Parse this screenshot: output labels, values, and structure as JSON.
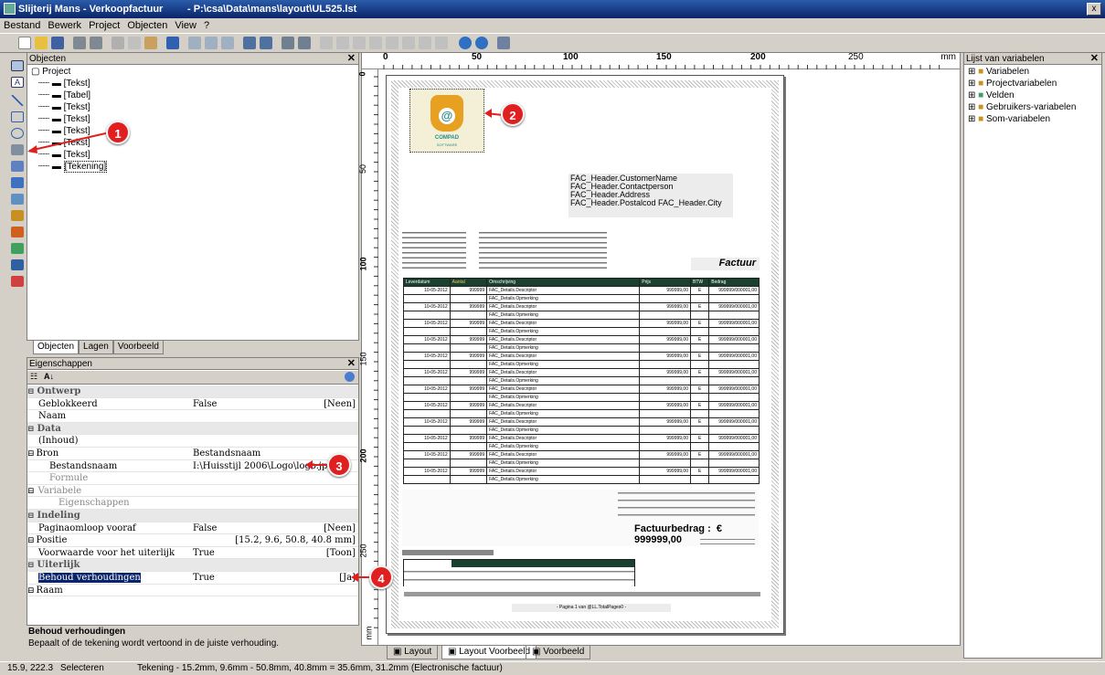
{
  "window": {
    "title": "Slijterij Mans - Verkoopfactuur",
    "path": "- P:\\csa\\Data\\mans\\layout\\UL525.lst",
    "close": "x"
  },
  "menu": [
    "Bestand",
    "Bewerk",
    "Project",
    "Objecten",
    "View",
    "?"
  ],
  "objects_panel": {
    "title": "Objecten",
    "root": "Project",
    "items": [
      "[Tekst]",
      "[Tabel]",
      "[Tekst]",
      "[Tekst]",
      "[Tekst]",
      "[Tekst]",
      "[Tekst]",
      "[Tekening]"
    ],
    "tabs": [
      "Objecten",
      "Lagen",
      "Voorbeeld"
    ]
  },
  "properties_panel": {
    "title": "Eigenschappen",
    "rows": [
      {
        "name": "Ontwerp",
        "type": "cat"
      },
      {
        "name": "Geblokkeerd",
        "value": "False",
        "right": "[Neen]"
      },
      {
        "name": "Naam",
        "value": "",
        "right": ""
      },
      {
        "name": "Data",
        "type": "cat"
      },
      {
        "name": "(Inhoud)",
        "value": "",
        "right": ""
      },
      {
        "name": "Bron",
        "value": "Bestandsnaam",
        "right": ""
      },
      {
        "name": "Bestandsnaam",
        "value": "I:\\Huisstijl 2006\\Logo\\logo.jpg",
        "right": ""
      },
      {
        "name": "Formule",
        "value": "",
        "right": ""
      },
      {
        "name": "Variabele",
        "value": "",
        "right": ""
      },
      {
        "name": "Eigenschappen",
        "value": "",
        "right": ""
      },
      {
        "name": "Indeling",
        "type": "cat"
      },
      {
        "name": "Paginaomloop vooraf",
        "value": "False",
        "right": "[Neen]"
      },
      {
        "name": "Positie",
        "value": "",
        "right": "[15.2, 9.6, 50.8, 40.8 mm]"
      },
      {
        "name": "Voorwaarde voor het uiterlijk",
        "value": "True",
        "right": "[Toon]"
      },
      {
        "name": "Uiterlijk",
        "type": "cat"
      },
      {
        "name": "Behoud verhoudingen",
        "value": "True",
        "right": "[Ja]"
      },
      {
        "name": "Raam",
        "value": "",
        "right": ""
      }
    ],
    "help_title": "Behoud verhoudingen",
    "help_text": "Bepaalt of de tekening wordt vertoond in de juiste verhouding."
  },
  "ruler": {
    "unit": "mm",
    "h_ticks": [
      "0",
      "50",
      "100",
      "150",
      "200",
      "250"
    ],
    "v_ticks": [
      "0",
      "50",
      "100",
      "150",
      "200",
      "250"
    ]
  },
  "variables_panel": {
    "title": "Lijst van variabelen",
    "items": [
      "Variabelen",
      "Projectvariabelen",
      "Velden",
      "Gebruikers-variabelen",
      "Som-variabelen"
    ]
  },
  "invoice": {
    "logo_text": "COMPAD",
    "logo_sub": "SOFTWARE",
    "address": [
      "FAC_Header.CustomerName",
      "FAC_Header.Contactperson",
      "FAC_Header.Address",
      "FAC_Header.Postalcod FAC_Header.City"
    ],
    "title": "Factuur",
    "total_label": "Factuurbedrag :",
    "total_currency": "€",
    "total_value": "999999,00",
    "table_headers": [
      "Leverdatum",
      "Aantal",
      "Omschrijving",
      "Prijs",
      "BTW",
      "Bedrag"
    ],
    "row_date": "10-05-2012",
    "row_qty": "999999",
    "row_desc1": "FAC_Details.Descriptor",
    "row_desc2": "FAC_Details.Opmerking",
    "row_price": "999999,00",
    "row_btw": "E",
    "row_amount": "999999/000001,00",
    "footer": "- Pagina 1 van @LL.TotalPages0 -"
  },
  "view_tabs": [
    "Layout",
    "Layout Voorbeeld",
    "Voorbeeld"
  ],
  "status": {
    "coords": "15.9, 222.3",
    "mode": "Selecteren",
    "info": "Tekening - 15.2mm, 9.6mm - 50.8mm, 40.8mm = 35.6mm, 31.2mm (Electronische factuur)"
  },
  "markers": [
    "1",
    "2",
    "3",
    "4"
  ]
}
